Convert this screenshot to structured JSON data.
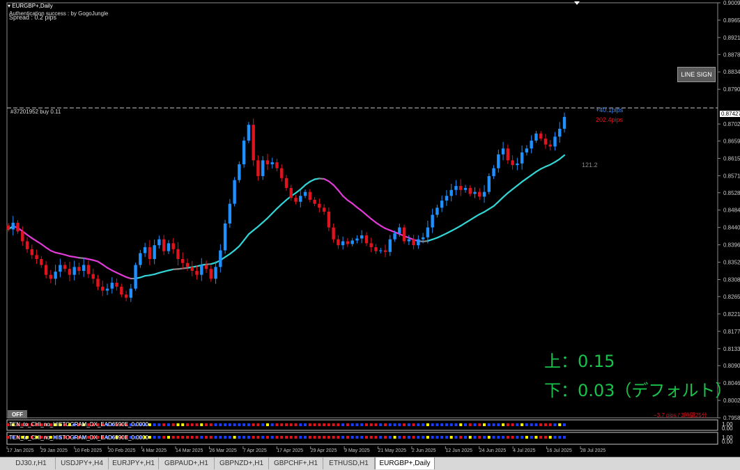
{
  "window": {
    "symbol_title": "EURGBP+,Daily",
    "auth_text": "Authentication success : by GogoJungle",
    "spread_text": "Spread : 0.2 pips",
    "line_sign_label": "LINE SIGN",
    "off_label": "OFF"
  },
  "order_line": {
    "label": "#37201952 buy 0.11",
    "pips_text": "+40.1pips",
    "pips_text2": "202.4pips",
    "price_label": "0.87427"
  },
  "annotations": {
    "value_label": "121.2",
    "upper_setting": "上：0.15",
    "lower_setting": "下：0.03（デフォルト）",
    "timer_text": "−3.7 pips / 3時間25分"
  },
  "indicators": [
    {
      "label": "TEN_to_CHI_no_HISTOGRAM_DX_EAD6590E_0.0000",
      "scale_top": "1.00",
      "scale_bottom": "0.00"
    },
    {
      "label": "TEN_to_CHI_no_HISTOGRAM_DX_EAD6590E_0.0000",
      "scale_top": "1.00",
      "scale_bottom": "0.00"
    }
  ],
  "colors": {
    "bull": "#1e90ff",
    "bear": "#e0141e",
    "ma_up": "#33d6d6",
    "ma_down": "#e23ad6",
    "ma_flat": "#8c8c8c",
    "green_text": "#19c24a",
    "ind_blue": "#1a3cff",
    "ind_red": "#e0141e",
    "ind_yellow": "#ffff00"
  },
  "tabs": [
    {
      "label": "DJ30.r,H1"
    },
    {
      "label": "USDJPY+,H4"
    },
    {
      "label": "EURJPY+,H1"
    },
    {
      "label": "GBPAUD+,H1"
    },
    {
      "label": "GBPNZD+,H1"
    },
    {
      "label": "GBPCHF+,H1"
    },
    {
      "label": "ETHUSD,H1"
    },
    {
      "label": "EURGBP+,Daily",
      "active": true
    }
  ],
  "chart_data": {
    "type": "candlestick",
    "title": "EURGBP+,Daily",
    "ylim": [
      0.7958,
      0.9009
    ],
    "y_ticks": [
      "0.90090",
      "0.89650",
      "0.89210",
      "0.88780",
      "0.88340",
      "0.87900",
      "0.87427",
      "0.87020",
      "0.86590",
      "0.86150",
      "0.85710",
      "0.85280",
      "0.84840",
      "0.84400",
      "0.83960",
      "0.83520",
      "0.83080",
      "0.82650",
      "0.82210",
      "0.81770",
      "0.81330",
      "0.80900",
      "0.80460",
      "0.80020",
      "0.79580"
    ],
    "x_labels": [
      "17 Jan 2025",
      "29 Jan 2025",
      "10 Feb 2025",
      "20 Feb 2025",
      "4 Mar 2025",
      "14 Mar 2025",
      "26 Mar 2025",
      "7 Apr 2025",
      "17 Apr 2025",
      "29 Apr 2025",
      "9 May 2025",
      "21 May 2025",
      "2 Jun 2025",
      "12 Jun 2025",
      "24 Jun 2025",
      "4 Jul 2025",
      "16 Jul 2025",
      "28 Jul 2025"
    ],
    "current_price": 0.87427,
    "closes": [
      0.8435,
      0.8452,
      0.843,
      0.8405,
      0.8385,
      0.837,
      0.836,
      0.8345,
      0.832,
      0.831,
      0.8328,
      0.8345,
      0.8335,
      0.832,
      0.834,
      0.833,
      0.8345,
      0.8322,
      0.831,
      0.829,
      0.828,
      0.8285,
      0.83,
      0.829,
      0.827,
      0.8262,
      0.8285,
      0.8345,
      0.8375,
      0.839,
      0.836,
      0.8395,
      0.841,
      0.838,
      0.84,
      0.8385,
      0.836,
      0.835,
      0.834,
      0.833,
      0.832,
      0.8345,
      0.8335,
      0.831,
      0.834,
      0.8382,
      0.845,
      0.85,
      0.856,
      0.86,
      0.866,
      0.87,
      0.861,
      0.857,
      0.861,
      0.86,
      0.8605,
      0.859,
      0.8565,
      0.854,
      0.8515,
      0.8505,
      0.852,
      0.853,
      0.851,
      0.85,
      0.849,
      0.848,
      0.844,
      0.841,
      0.8395,
      0.8405,
      0.8398,
      0.8407,
      0.8412,
      0.842,
      0.84,
      0.839,
      0.838,
      0.8382,
      0.8378,
      0.841,
      0.8425,
      0.844,
      0.8405,
      0.841,
      0.8395,
      0.841,
      0.8415,
      0.844,
      0.8472,
      0.849,
      0.8508,
      0.852,
      0.8535,
      0.8545,
      0.8535,
      0.854,
      0.8525,
      0.853,
      0.8518,
      0.853,
      0.857,
      0.859,
      0.8625,
      0.864,
      0.861,
      0.8598,
      0.8602,
      0.863,
      0.864,
      0.866,
      0.8678,
      0.8665,
      0.865,
      0.8645,
      0.867,
      0.869,
      0.872
    ]
  }
}
